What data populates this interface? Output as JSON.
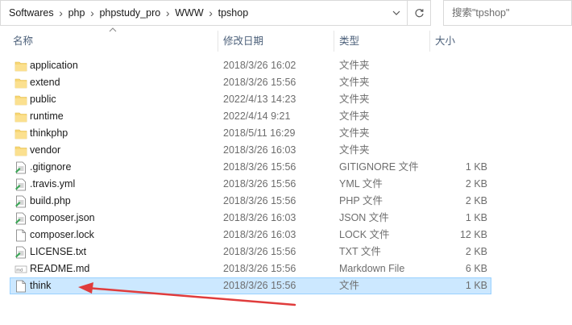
{
  "address_bar": {
    "path": [
      "Softwares",
      "php",
      "phpstudy_pro",
      "WWW",
      "tpshop"
    ]
  },
  "search": {
    "placeholder": "搜索\"tpshop\""
  },
  "columns": {
    "name": "名称",
    "date": "修改日期",
    "type": "类型",
    "size": "大小"
  },
  "files": [
    {
      "name": "application",
      "date": "2018/3/26 16:02",
      "type": "文件夹",
      "size": "",
      "icon": "folder-icon"
    },
    {
      "name": "extend",
      "date": "2018/3/26 15:56",
      "type": "文件夹",
      "size": "",
      "icon": "folder-icon"
    },
    {
      "name": "public",
      "date": "2022/4/13 14:23",
      "type": "文件夹",
      "size": "",
      "icon": "folder-icon"
    },
    {
      "name": "runtime",
      "date": "2022/4/14 9:21",
      "type": "文件夹",
      "size": "",
      "icon": "folder-icon"
    },
    {
      "name": "thinkphp",
      "date": "2018/5/11 16:29",
      "type": "文件夹",
      "size": "",
      "icon": "folder-icon"
    },
    {
      "name": "vendor",
      "date": "2018/3/26 16:03",
      "type": "文件夹",
      "size": "",
      "icon": "folder-icon"
    },
    {
      "name": ".gitignore",
      "date": "2018/3/26 15:56",
      "type": "GITIGNORE 文件",
      "size": "1 KB",
      "icon": "text-file-icon"
    },
    {
      "name": ".travis.yml",
      "date": "2018/3/26 15:56",
      "type": "YML 文件",
      "size": "2 KB",
      "icon": "text-file-icon"
    },
    {
      "name": "build.php",
      "date": "2018/3/26 15:56",
      "type": "PHP 文件",
      "size": "2 KB",
      "icon": "text-file-icon"
    },
    {
      "name": "composer.json",
      "date": "2018/3/26 16:03",
      "type": "JSON 文件",
      "size": "1 KB",
      "icon": "text-file-icon"
    },
    {
      "name": "composer.lock",
      "date": "2018/3/26 16:03",
      "type": "LOCK 文件",
      "size": "12 KB",
      "icon": "blank-file-icon"
    },
    {
      "name": "LICENSE.txt",
      "date": "2018/3/26 15:56",
      "type": "TXT 文件",
      "size": "2 KB",
      "icon": "text-file-icon"
    },
    {
      "name": "README.md",
      "date": "2018/3/26 15:56",
      "type": "Markdown File",
      "size": "6 KB",
      "icon": "markdown-file-icon"
    },
    {
      "name": "think",
      "date": "2018/3/26 15:56",
      "type": "文件",
      "size": "1 KB",
      "icon": "blank-file-icon",
      "selected": true
    }
  ],
  "colors": {
    "selection_bg": "#cce8ff",
    "selection_border": "#99d1ff",
    "annotation_arrow": "#e03c3c",
    "folder": "#f8d775",
    "header_text": "#4c607a"
  }
}
